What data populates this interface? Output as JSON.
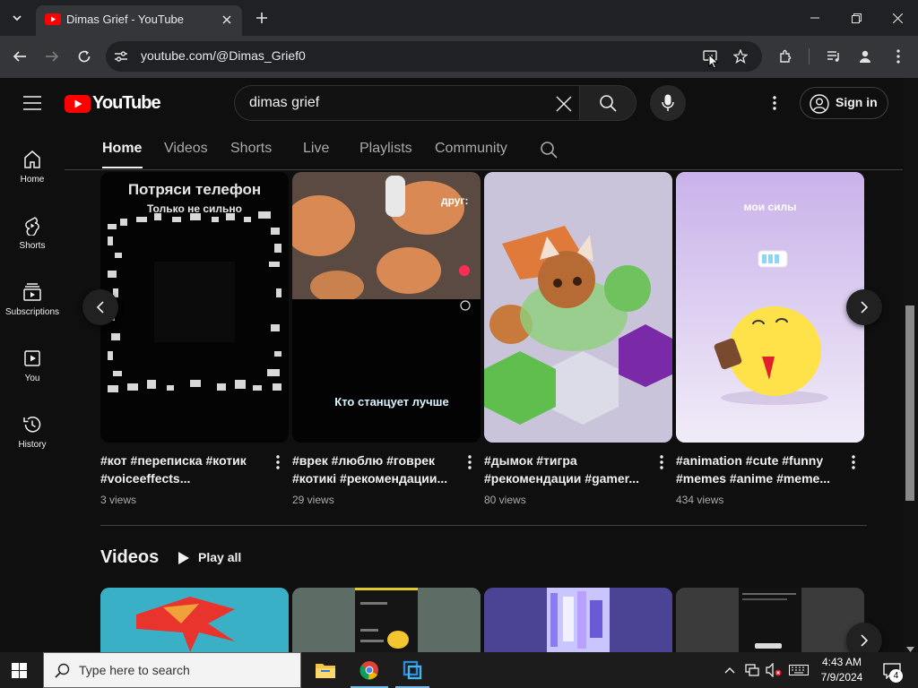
{
  "browser": {
    "tab_title": "Dimas Grief - YouTube",
    "url": "youtube.com/@Dimas_Grief0"
  },
  "youtube": {
    "logo_text": "YouTube",
    "search_value": "dimas grief",
    "sign_in": "Sign in",
    "sidebar": [
      {
        "label": "Home",
        "icon": "home-icon"
      },
      {
        "label": "Shorts",
        "icon": "shorts-icon"
      },
      {
        "label": "Subscriptions",
        "icon": "subscriptions-icon"
      },
      {
        "label": "You",
        "icon": "you-icon"
      },
      {
        "label": "History",
        "icon": "history-icon"
      }
    ],
    "tabs": [
      "Home",
      "Videos",
      "Shorts",
      "Live",
      "Playlists",
      "Community"
    ],
    "active_tab": "Home",
    "shorts": [
      {
        "title_l1": "#кот #переписка #котик",
        "title_l2": "#voiceeffects...",
        "views": "3 views",
        "overlay_top": "Потряси телефон",
        "overlay_sub": "Только не сильно"
      },
      {
        "title_l1": "#врек #люблю #говрек",
        "title_l2": "#котикі #рекомендации...",
        "views": "29 views",
        "overlay_top": "друг:",
        "overlay_bottom": "Кто станцует лучше"
      },
      {
        "title_l1": "#дымок #тигра",
        "title_l2": "#рекомендации #gamer...",
        "views": "80 views"
      },
      {
        "title_l1": "#animation #cute #funny",
        "title_l2": "#memes #anime #meme...",
        "views": "434 views",
        "overlay_top": "мои силы"
      }
    ],
    "videos_heading": "Videos",
    "play_all": "Play all"
  },
  "taskbar": {
    "search_placeholder": "Type here to search",
    "time": "4:43 AM",
    "date": "7/9/2024",
    "notifications": "4"
  },
  "colors": {
    "yt_red": "#ff0000",
    "bg": "#0f0f0f",
    "chrome_dark": "#202124",
    "chrome_toolbar": "#35363a"
  }
}
